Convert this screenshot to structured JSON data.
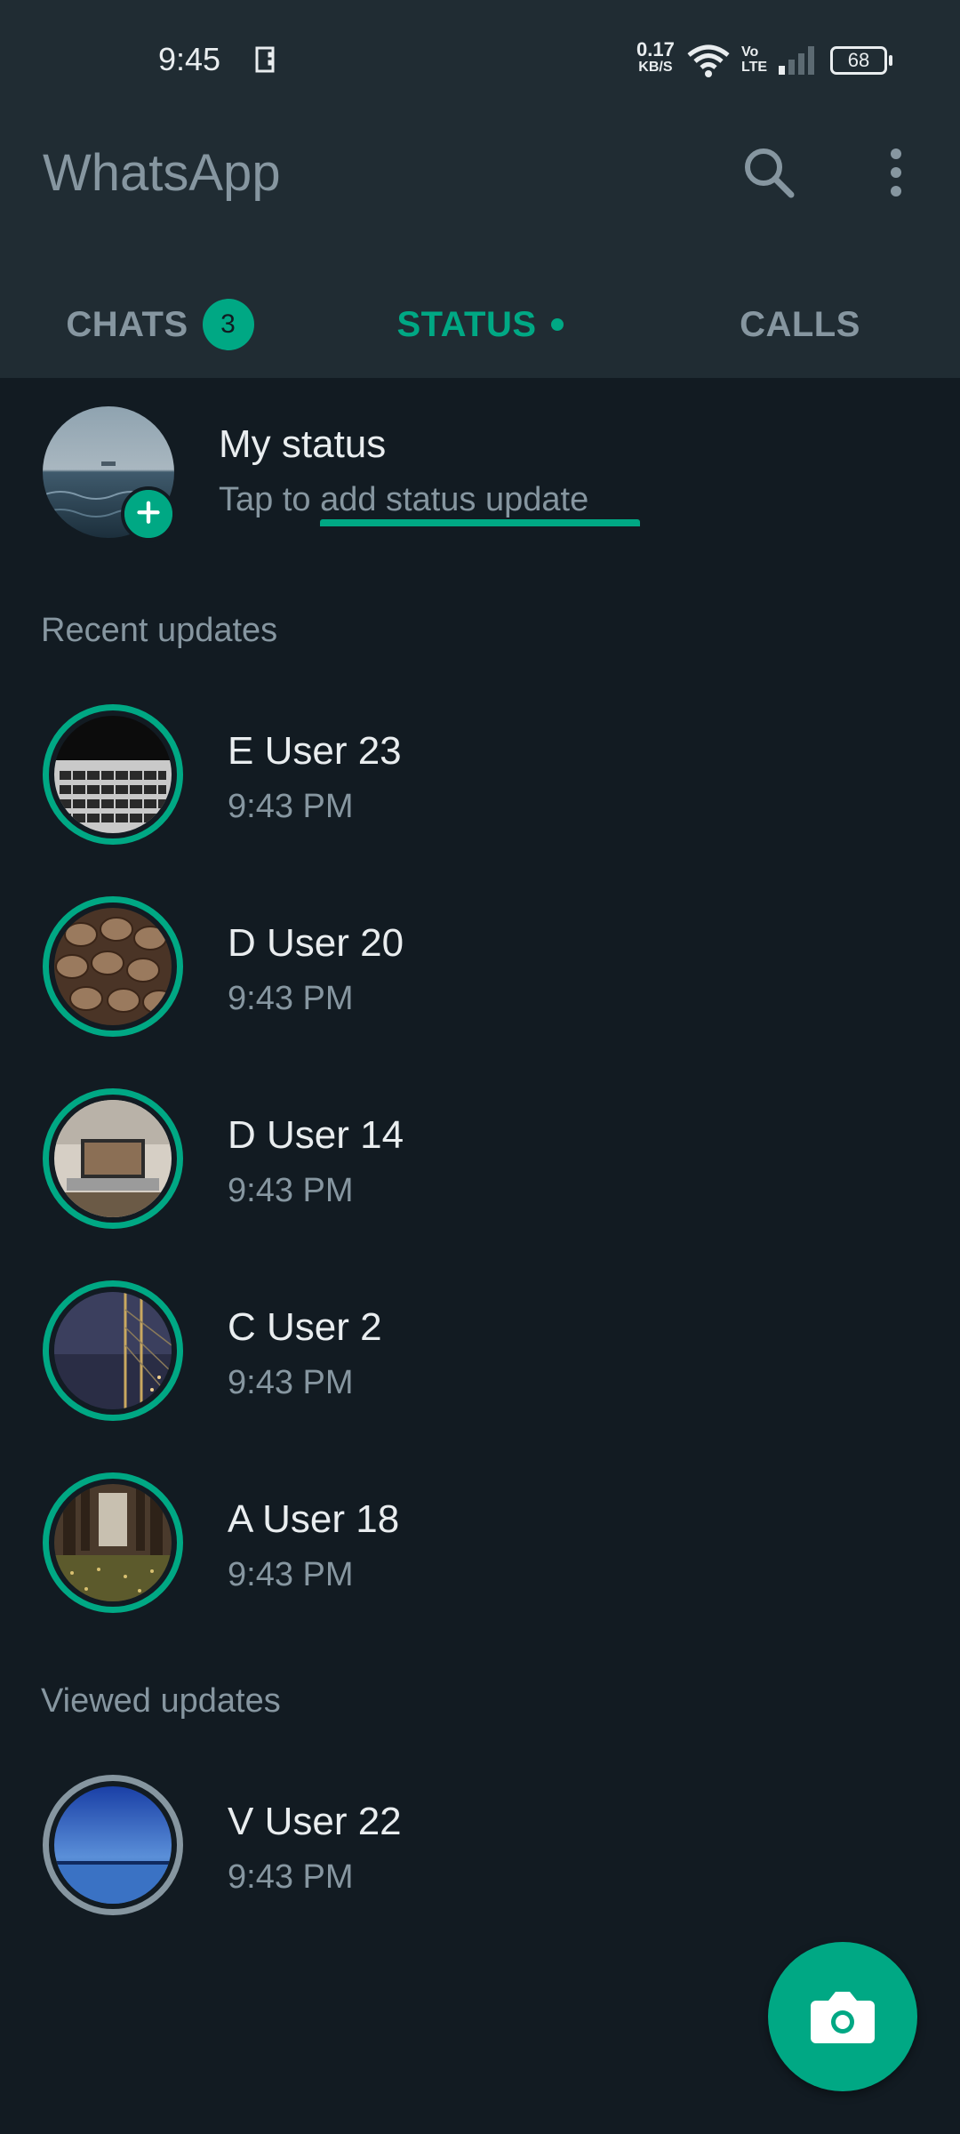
{
  "status_bar": {
    "time": "9:45",
    "net_speed_value": "0.17",
    "net_speed_unit": "KB/S",
    "volte_top": "Vo",
    "volte_bottom": "LTE",
    "battery": "68"
  },
  "app_bar": {
    "title": "WhatsApp",
    "search_icon": "search-icon",
    "menu_icon": "more-vert-icon"
  },
  "tabs": [
    {
      "label": "CHATS",
      "badge": "3"
    },
    {
      "label": "STATUS",
      "selected": true
    },
    {
      "label": "CALLS"
    }
  ],
  "my_status": {
    "name": "My status",
    "subtitle": "Tap to add status update"
  },
  "recent_header": "Recent updates",
  "recent": [
    {
      "name": "E User 23",
      "time": "9:43 PM"
    },
    {
      "name": "D User 20",
      "time": "9:43 PM"
    },
    {
      "name": "D User 14",
      "time": "9:43 PM"
    },
    {
      "name": "C User 2",
      "time": "9:43 PM"
    },
    {
      "name": "A User 18",
      "time": "9:43 PM"
    }
  ],
  "viewed_header": "Viewed updates",
  "viewed": [
    {
      "name": "V User 22",
      "time": "9:43 PM"
    }
  ],
  "fab_icon": "camera-icon",
  "colors": {
    "accent": "#00a884",
    "background": "#121b22",
    "header": "#202c33",
    "secondary_text": "#8696a0",
    "primary_text": "#e9edef"
  }
}
